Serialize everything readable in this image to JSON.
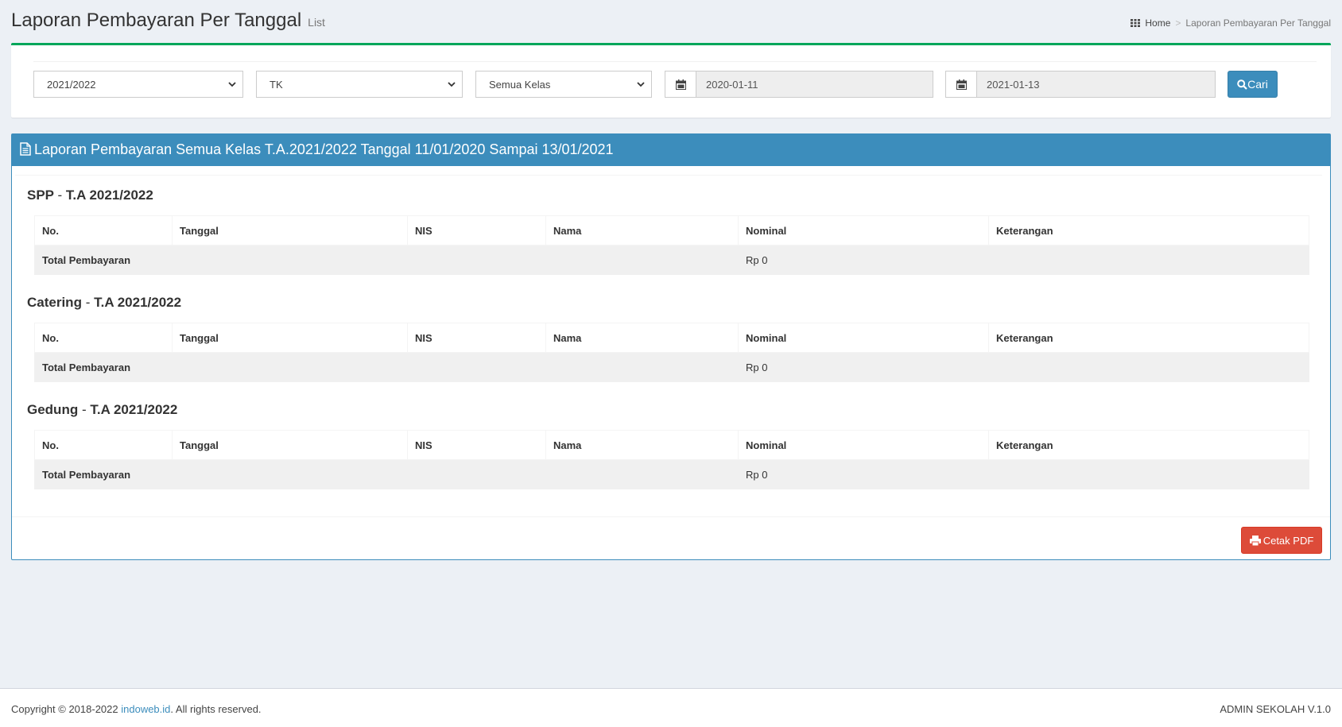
{
  "header": {
    "title": "Laporan Pembayaran Per Tanggal",
    "subtitle": "List",
    "breadcrumb": {
      "home": "Home",
      "separator": ">",
      "current": "Laporan Pembayaran Per Tanggal"
    }
  },
  "filters": {
    "tahun_ajaran": "2021/2022",
    "jenjang": "TK",
    "kelas": "Semua Kelas",
    "tanggal_awal": "2020-01-11",
    "tanggal_akhir": "2021-01-13",
    "search_label": "Cari"
  },
  "report": {
    "title": "Laporan Pembayaran Semua Kelas T.A.2021/2022 Tanggal 11/01/2020 Sampai 13/01/2021",
    "columns": [
      "No.",
      "Tanggal",
      "NIS",
      "Nama",
      "Nominal",
      "Keterangan"
    ],
    "total_label": "Total Pembayaran",
    "dash": "-",
    "sections": [
      {
        "name": "SPP",
        "ta": "T.A 2021/2022",
        "total": "Rp 0"
      },
      {
        "name": "Catering",
        "ta": "T.A 2021/2022",
        "total": "Rp 0"
      },
      {
        "name": "Gedung",
        "ta": "T.A 2021/2022",
        "total": "Rp 0"
      }
    ],
    "print_label": "Cetak PDF"
  },
  "footer": {
    "copyright_prefix": "Copyright © 2018-2022 ",
    "link": "indoweb.id",
    "copyright_suffix": ". All rights reserved.",
    "version": "ADMIN SEKOLAH V.1.0"
  },
  "colors": {
    "primary": "#3c8dbc",
    "success_border": "#00a65a",
    "danger": "#dd4b39",
    "background": "#ecf0f5"
  }
}
